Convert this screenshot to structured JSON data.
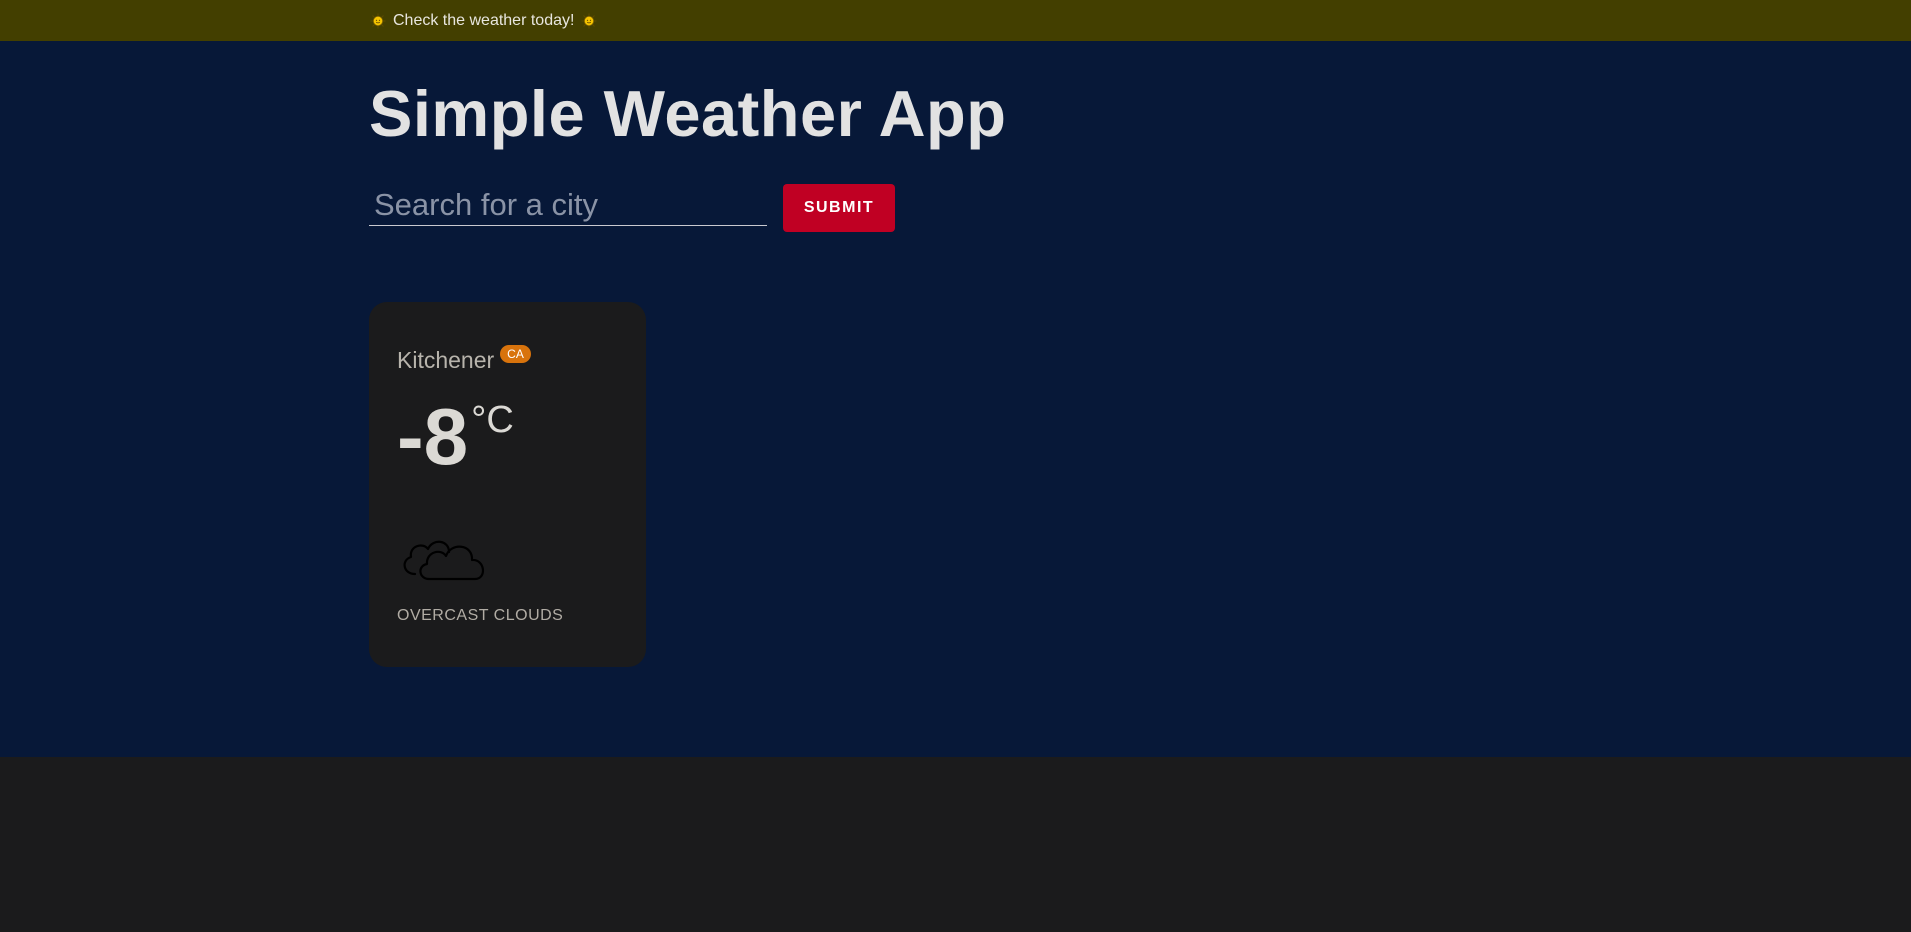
{
  "banner": {
    "left_icon": "sun-icon",
    "text": "Check the weather today!",
    "right_icon": "sun-icon"
  },
  "header": {
    "title": "Simple Weather App"
  },
  "search": {
    "placeholder": "Search for a city",
    "value": "",
    "submit_label": "SUBMIT"
  },
  "weather_card": {
    "city": "Kitchener",
    "country": "CA",
    "temperature": "-8",
    "unit": "°C",
    "icon": "cloud-icon",
    "description": "overcast clouds"
  },
  "colors": {
    "banner_bg": "#433f00",
    "hero_bg": "#071838",
    "card_bg": "#1b1b1c",
    "submit_bg": "#c00023",
    "badge_bg": "#d8730c",
    "footer_bg": "#1b1b1c"
  }
}
